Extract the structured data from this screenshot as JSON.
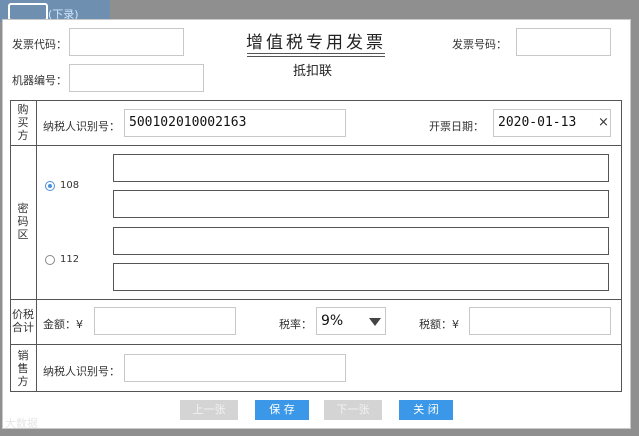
{
  "background": {
    "link_text": "(下录)"
  },
  "header": {
    "invoice_code_label": "发票代码：",
    "invoice_number_label": "发票号码：",
    "machine_number_label": "机器编号：",
    "title": "增值税专用发票",
    "subtitle": "抵扣联"
  },
  "buyer": {
    "section_label": [
      "购",
      "买",
      "方"
    ],
    "tax_id_label": "纳税人识别号：",
    "tax_id_value": "500102010002163",
    "issue_date_label": "开票日期：",
    "issue_date_value": "2020-01-13",
    "clear_icon": "×"
  },
  "cipher": {
    "section_label": [
      "密",
      "码",
      "区"
    ],
    "options": [
      {
        "label": "108",
        "selected": true
      },
      {
        "label": "112",
        "selected": false
      }
    ]
  },
  "price_tax": {
    "section_label": [
      "价税",
      "合计"
    ],
    "amount_label": "金额：¥",
    "tax_rate_label": "税率：",
    "tax_rate_value": "9%",
    "tax_amount_label": "税额：¥"
  },
  "seller": {
    "section_label": [
      "销",
      "售",
      "方"
    ],
    "tax_id_label": "纳税人识别号："
  },
  "buttons": {
    "prev": "上一张",
    "save": "保 存",
    "next": "下一张",
    "close": "关 闭"
  },
  "watermark": "大数据"
}
